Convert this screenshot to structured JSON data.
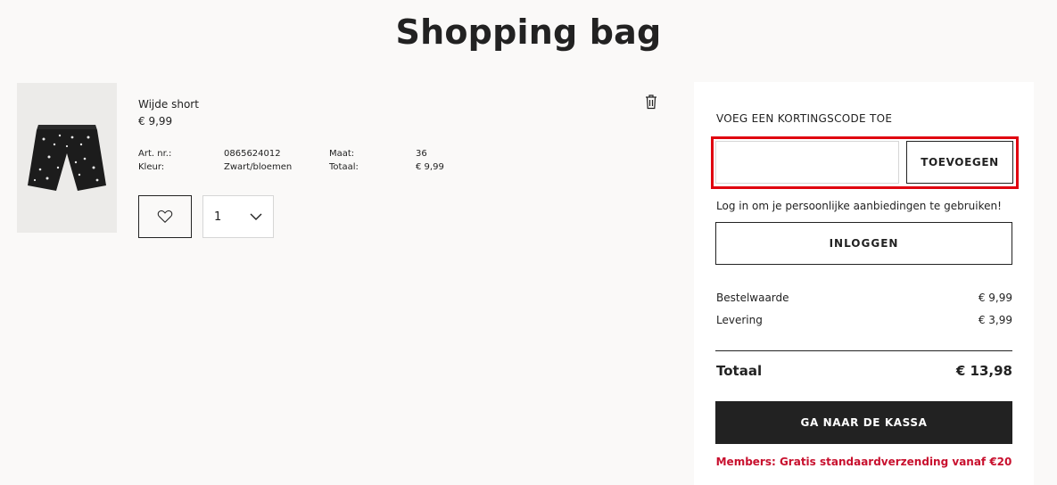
{
  "header": {
    "title": "Shopping bag"
  },
  "item": {
    "name": "Wijde short",
    "price": "€ 9,99",
    "details": {
      "art_label": "Art. nr.:",
      "art_value": "0865624012",
      "color_label": "Kleur:",
      "color_value": "Zwart/bloemen",
      "size_label": "Maat:",
      "size_value": "36",
      "total_label": "Totaal:",
      "total_value": "€ 9,99"
    },
    "quantity": "1",
    "icons": {
      "delete": "trash-icon",
      "favourite": "heart-icon",
      "dropdown": "chevron-down-icon"
    }
  },
  "summary": {
    "discount_heading": "VOEG EEN KORTINGSCODE TOE",
    "discount_value": "",
    "add_button": "TOEVOEGEN",
    "login_prompt": "Log in om je persoonlijke aanbiedingen te gebruiken!",
    "login_button": "INLOGGEN",
    "lines": [
      {
        "label": "Bestelwaarde",
        "value": "€ 9,99"
      },
      {
        "label": "Levering",
        "value": "€ 3,99"
      }
    ],
    "total_label": "Totaal",
    "total_value": "€ 13,98",
    "checkout_button": "GA NAAR DE KASSA",
    "members_note": "Members: Gratis standaardverzending vanaf €20"
  },
  "colors": {
    "background": "#faf9f8",
    "text": "#222222",
    "highlight": "#e0010f",
    "members": "#c8102e",
    "checkout_bg": "#222222"
  }
}
